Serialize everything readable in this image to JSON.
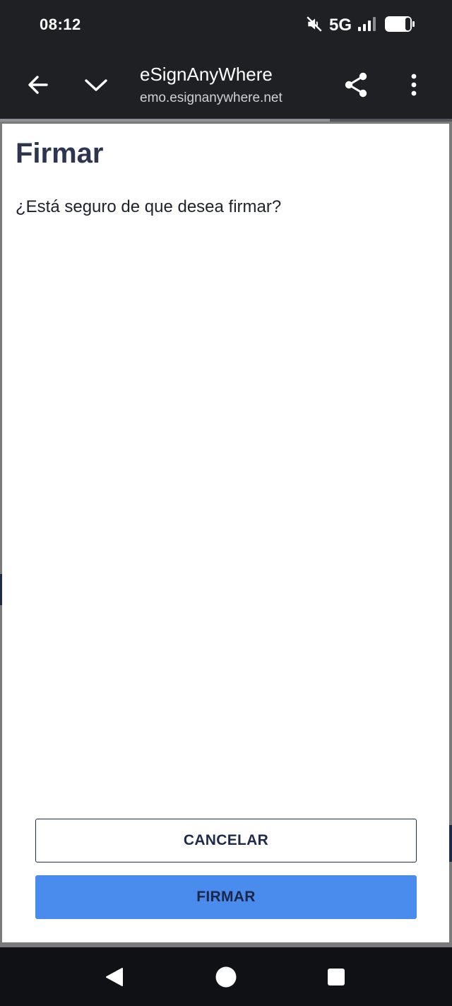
{
  "status_bar": {
    "time": "08:12",
    "network": "5G",
    "icons": [
      "mute-icon",
      "signal-icon",
      "battery-icon"
    ]
  },
  "browser": {
    "site_title": "eSignAnyWhere",
    "site_url": "emo.esignanywhere.net",
    "icons": [
      "back-arrow-icon",
      "chevron-down-icon",
      "share-icon",
      "more-vert-icon"
    ]
  },
  "dialog": {
    "title": "Firmar",
    "message": "¿Está seguro de que desea firmar?",
    "cancel_label": "CANCELAR",
    "sign_label": "FIRMAR"
  },
  "nav_bar": {
    "icons": [
      "back-triangle-icon",
      "home-circle-icon",
      "recents-square-icon"
    ]
  },
  "colors": {
    "system_bar": "#1e2023",
    "primary_button": "#4a8cee",
    "heading_text": "#2e3550",
    "outline_button": "#1f2b4d"
  }
}
